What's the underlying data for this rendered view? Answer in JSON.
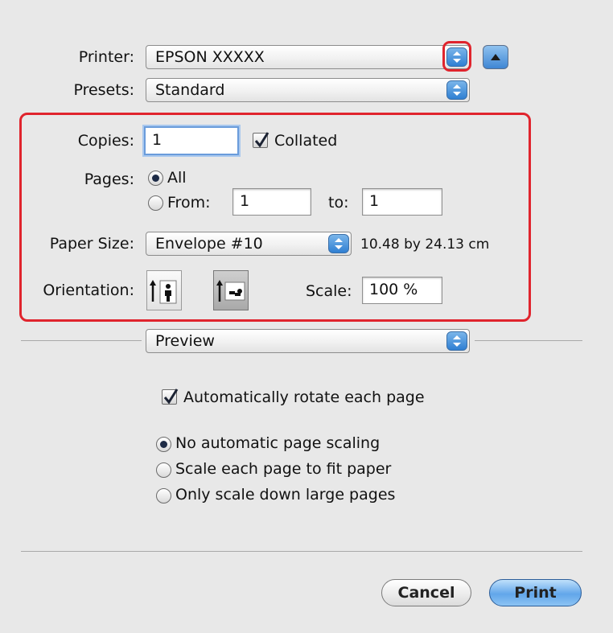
{
  "printer": {
    "label": "Printer:",
    "value": "EPSON XXXXX"
  },
  "presets": {
    "label": "Presets:",
    "value": "Standard"
  },
  "copies": {
    "label": "Copies:",
    "value": "1",
    "collated_label": "Collated",
    "collated_checked": true
  },
  "pages": {
    "label": "Pages:",
    "all_label": "All",
    "from_label": "From:",
    "from_value": "1",
    "to_label": "to:",
    "to_value": "1",
    "selected": "All"
  },
  "paper_size": {
    "label": "Paper Size:",
    "value": "Envelope #10",
    "dimensions": "10.48 by 24.13 cm"
  },
  "orientation": {
    "label": "Orientation:",
    "selected": "landscape"
  },
  "scale": {
    "label": "Scale:",
    "value": "100 %"
  },
  "section_popup": {
    "value": "Preview"
  },
  "preview_options": {
    "auto_rotate_label": "Automatically rotate each page",
    "auto_rotate_checked": true,
    "scaling_options": [
      "No automatic page scaling",
      "Scale each page to fit paper",
      "Only scale down large pages"
    ],
    "scaling_selected": 0
  },
  "buttons": {
    "cancel": "Cancel",
    "print": "Print"
  },
  "colors": {
    "highlight": "#e0242d",
    "accent": "#4a90e2"
  }
}
